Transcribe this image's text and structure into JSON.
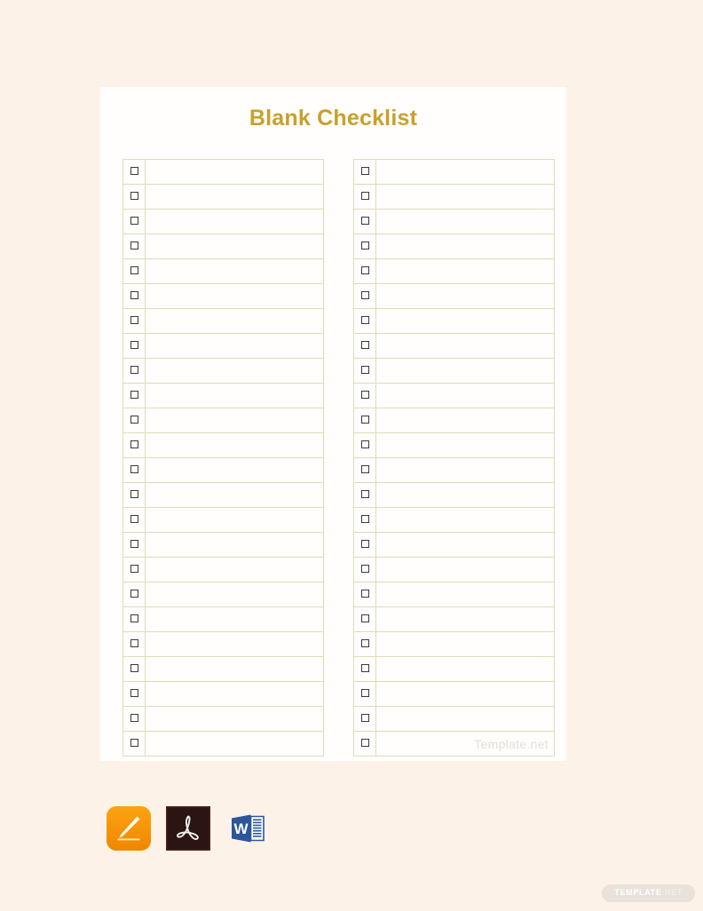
{
  "page": {
    "background_color": "#fdf2e7",
    "card_background": "#fffefc"
  },
  "document": {
    "title": "Blank Checklist",
    "title_color": "#c9a02a",
    "border_color": "#e0dbb8",
    "watermark": "Template.net",
    "watermark_color": "#e3ded9"
  },
  "checklist": {
    "row_count_per_column": 24,
    "columns": [
      {
        "name": "left-column",
        "rows": [
          {
            "checked": false,
            "text": ""
          },
          {
            "checked": false,
            "text": ""
          },
          {
            "checked": false,
            "text": ""
          },
          {
            "checked": false,
            "text": ""
          },
          {
            "checked": false,
            "text": ""
          },
          {
            "checked": false,
            "text": ""
          },
          {
            "checked": false,
            "text": ""
          },
          {
            "checked": false,
            "text": ""
          },
          {
            "checked": false,
            "text": ""
          },
          {
            "checked": false,
            "text": ""
          },
          {
            "checked": false,
            "text": ""
          },
          {
            "checked": false,
            "text": ""
          },
          {
            "checked": false,
            "text": ""
          },
          {
            "checked": false,
            "text": ""
          },
          {
            "checked": false,
            "text": ""
          },
          {
            "checked": false,
            "text": ""
          },
          {
            "checked": false,
            "text": ""
          },
          {
            "checked": false,
            "text": ""
          },
          {
            "checked": false,
            "text": ""
          },
          {
            "checked": false,
            "text": ""
          },
          {
            "checked": false,
            "text": ""
          },
          {
            "checked": false,
            "text": ""
          },
          {
            "checked": false,
            "text": ""
          },
          {
            "checked": false,
            "text": ""
          }
        ]
      },
      {
        "name": "right-column",
        "rows": [
          {
            "checked": false,
            "text": ""
          },
          {
            "checked": false,
            "text": ""
          },
          {
            "checked": false,
            "text": ""
          },
          {
            "checked": false,
            "text": ""
          },
          {
            "checked": false,
            "text": ""
          },
          {
            "checked": false,
            "text": ""
          },
          {
            "checked": false,
            "text": ""
          },
          {
            "checked": false,
            "text": ""
          },
          {
            "checked": false,
            "text": ""
          },
          {
            "checked": false,
            "text": ""
          },
          {
            "checked": false,
            "text": ""
          },
          {
            "checked": false,
            "text": ""
          },
          {
            "checked": false,
            "text": ""
          },
          {
            "checked": false,
            "text": ""
          },
          {
            "checked": false,
            "text": ""
          },
          {
            "checked": false,
            "text": ""
          },
          {
            "checked": false,
            "text": ""
          },
          {
            "checked": false,
            "text": ""
          },
          {
            "checked": false,
            "text": ""
          },
          {
            "checked": false,
            "text": ""
          },
          {
            "checked": false,
            "text": ""
          },
          {
            "checked": false,
            "text": ""
          },
          {
            "checked": false,
            "text": ""
          },
          {
            "checked": false,
            "text": "Template.net",
            "is_watermark": true
          }
        ]
      }
    ]
  },
  "format_icons": [
    {
      "name": "apple-pages-icon",
      "label": "Pages",
      "color": "#f59a1a"
    },
    {
      "name": "adobe-pdf-icon",
      "label": "PDF",
      "color": "#2b1513"
    },
    {
      "name": "microsoft-word-icon",
      "label": "Word",
      "color": "#2b579a"
    }
  ],
  "badge": {
    "text_main": "TEMPLATE",
    "text_suffix": ".NET",
    "background": "#e9e2da"
  }
}
